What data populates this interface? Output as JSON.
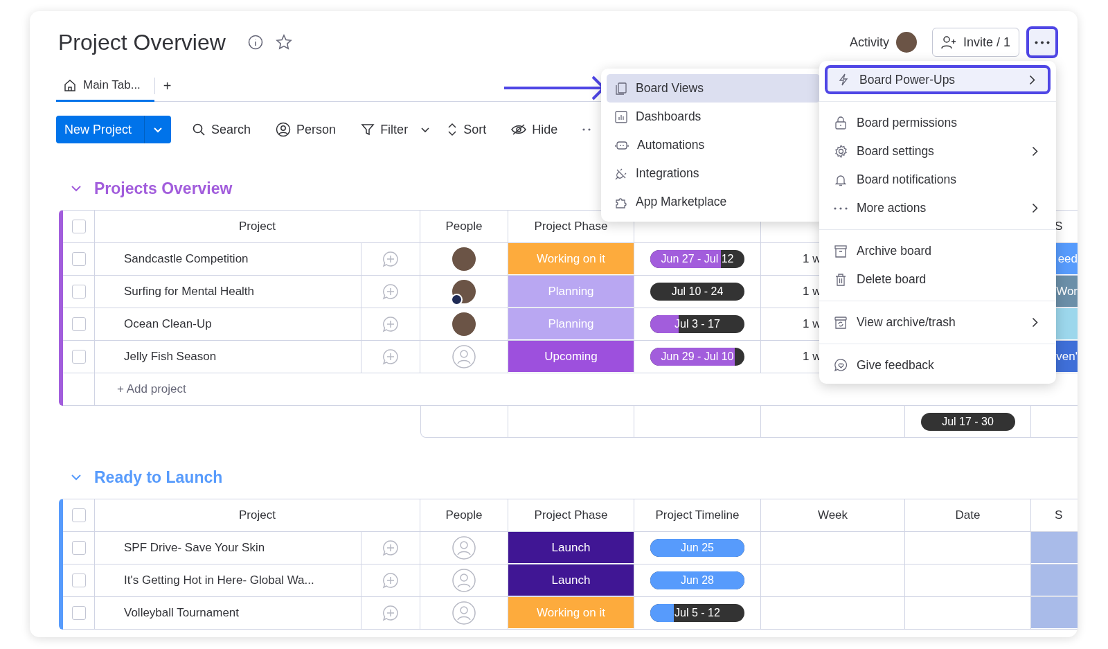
{
  "board": {
    "title": "Project Overview"
  },
  "header": {
    "activity": "Activity",
    "invite": "Invite / 1",
    "more_selected": true
  },
  "tabs": [
    {
      "label": "Main Tab...",
      "selected": true
    }
  ],
  "add_tab": "+",
  "toolbar": {
    "new_button": "New Project",
    "items": [
      {
        "kind": "search",
        "label": "Search"
      },
      {
        "kind": "person",
        "label": "Person"
      },
      {
        "kind": "filter",
        "label": "Filter"
      },
      {
        "kind": "sort",
        "label": "Sort"
      },
      {
        "kind": "hide",
        "label": "Hide"
      }
    ]
  },
  "groups": [
    {
      "title": "Projects Overview",
      "color": "#a25ddc",
      "all_checked": false,
      "columns": [
        "Project",
        "People",
        "Project Phase",
        "",
        "",
        "",
        "S"
      ],
      "rows": [
        {
          "name": "Sandcastle Competition",
          "checked": false,
          "person": {
            "kind": "photo",
            "badge": false
          },
          "phase": {
            "text": "Working on it",
            "color": "#fdab3d"
          },
          "timeline": {
            "text": "Jun 27 - Jul 12",
            "level": 0.75
          },
          "week": "1 w",
          "status": {
            "text": "eed",
            "color": "#579bfc"
          }
        },
        {
          "name": "Surfing for Mental Health",
          "checked": false,
          "person": {
            "kind": "photo",
            "badge": true
          },
          "phase": {
            "text": "Planning",
            "color": "#b9a7f2"
          },
          "timeline": {
            "text": "Jul 10 - 24"
          },
          "week": "1 w",
          "status": {
            "text": "Wor",
            "color": "#6b8fa8"
          }
        },
        {
          "name": "Ocean Clean-Up",
          "checked": false,
          "person": {
            "kind": "photo",
            "badge": false
          },
          "phase": {
            "text": "Planning",
            "color": "#b9a7f2"
          },
          "timeline": {
            "text": "Jul 3 - 17",
            "level": 0.3
          },
          "week": "1 w",
          "status": {
            "color": "#9cd7ec"
          }
        },
        {
          "name": "Jelly Fish Season",
          "checked": false,
          "person": {
            "kind": "empty"
          },
          "phase": {
            "text": "Upcoming",
            "color": "#9d50dd"
          },
          "timeline": {
            "text": "Jun 29 - Jul 10",
            "level": 0.9
          },
          "week": "1 w",
          "status": {
            "text": "ven'",
            "color": "#3f6fd8"
          }
        }
      ],
      "add_row": "+ Add project",
      "summary": {
        "timeline": {
          "text": "Jul 17 - 30"
        }
      }
    },
    {
      "title": "Ready to Launch",
      "color": "#579bfc",
      "all_checked": false,
      "columns": [
        "Project",
        "People",
        "Project Phase",
        "Project Timeline",
        "Week",
        "Date",
        "S"
      ],
      "rows": [
        {
          "name": "SPF Drive- Save Your Skin",
          "checked": false,
          "person": {
            "kind": "empty"
          },
          "phase": {
            "text": "Launch",
            "color": "#401694"
          },
          "timeline": {
            "text": "Jun 25",
            "level": 1
          },
          "status": {
            "color": "#a9bbe9"
          }
        },
        {
          "name": "It's Getting Hot in Here- Global Wa...",
          "checked": false,
          "person": {
            "kind": "empty"
          },
          "phase": {
            "text": "Launch",
            "color": "#401694"
          },
          "timeline": {
            "text": "Jun 28",
            "level": 1
          },
          "status": {
            "color": "#a9bbe9"
          }
        },
        {
          "name": "Volleyball Tournament",
          "checked": false,
          "person": {
            "kind": "empty"
          },
          "phase": {
            "text": "Working on it",
            "color": "#fdab3d"
          },
          "timeline": {
            "text": "Jul 5 - 12",
            "level": 0.25
          },
          "status": {
            "color": "#a9bbe9"
          }
        }
      ]
    }
  ],
  "views_menu": {
    "items": [
      {
        "kind": "views",
        "label": "Board Views",
        "selected": true
      },
      {
        "kind": "dashboards",
        "label": "Dashboards",
        "selected": false
      },
      {
        "kind": "automations",
        "label": "Automations",
        "selected": false
      },
      {
        "kind": "integrations",
        "label": "Integrations",
        "selected": false
      },
      {
        "kind": "marketplace",
        "label": "App Marketplace",
        "selected": false
      }
    ]
  },
  "more_menu": {
    "sections": [
      [
        {
          "kind": "bolt",
          "label": "Board Power-Ups",
          "submenu": true,
          "selected": true
        }
      ],
      [
        {
          "kind": "lock",
          "label": "Board permissions",
          "submenu": false,
          "selected": false
        },
        {
          "kind": "gear",
          "label": "Board settings",
          "submenu": true,
          "selected": false
        },
        {
          "kind": "bell",
          "label": "Board notifications",
          "submenu": false,
          "selected": false
        },
        {
          "kind": "dots",
          "label": "More actions",
          "submenu": true,
          "selected": false
        }
      ],
      [
        {
          "kind": "archive",
          "label": "Archive board",
          "submenu": false,
          "selected": false
        },
        {
          "kind": "trash",
          "label": "Delete board",
          "submenu": false,
          "selected": false
        }
      ],
      [
        {
          "kind": "restore",
          "label": "View archive/trash",
          "submenu": true,
          "selected": false
        }
      ],
      [
        {
          "kind": "feedback",
          "label": "Give feedback",
          "submenu": false,
          "selected": false
        }
      ]
    ]
  }
}
